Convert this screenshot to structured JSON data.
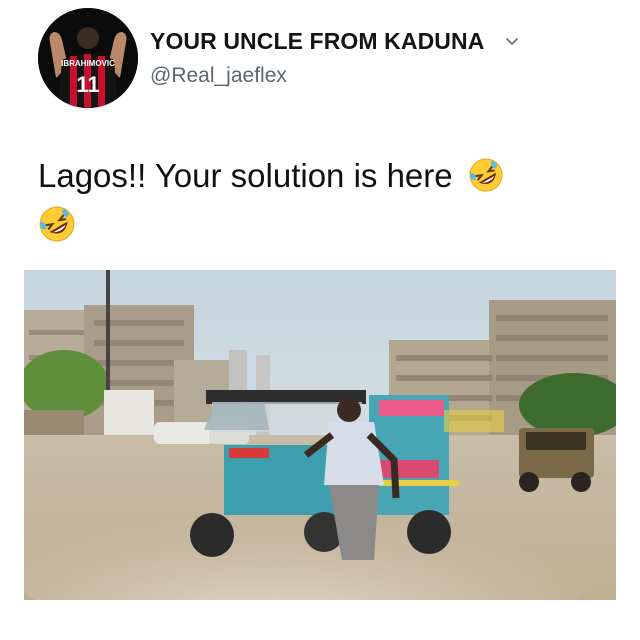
{
  "tweet": {
    "display_name": "YOUR UNCLE FROM KADUNA",
    "handle": "@Real_jaeflex",
    "text": "Lagos!! Your solution is here",
    "jersey_number": "11",
    "emoji_icon": "rolling-on-floor-laughing-emoji",
    "menu_icon": "chevron-down-icon",
    "media": {
      "type": "video-still",
      "description_icons": [
        "tricycle-icon",
        "jeep-icon"
      ]
    }
  },
  "colors": {
    "handle": "#5b6670",
    "jersey_red": "#c8102e",
    "sky": "#cfdce4",
    "ground": "#cdbfa8"
  }
}
